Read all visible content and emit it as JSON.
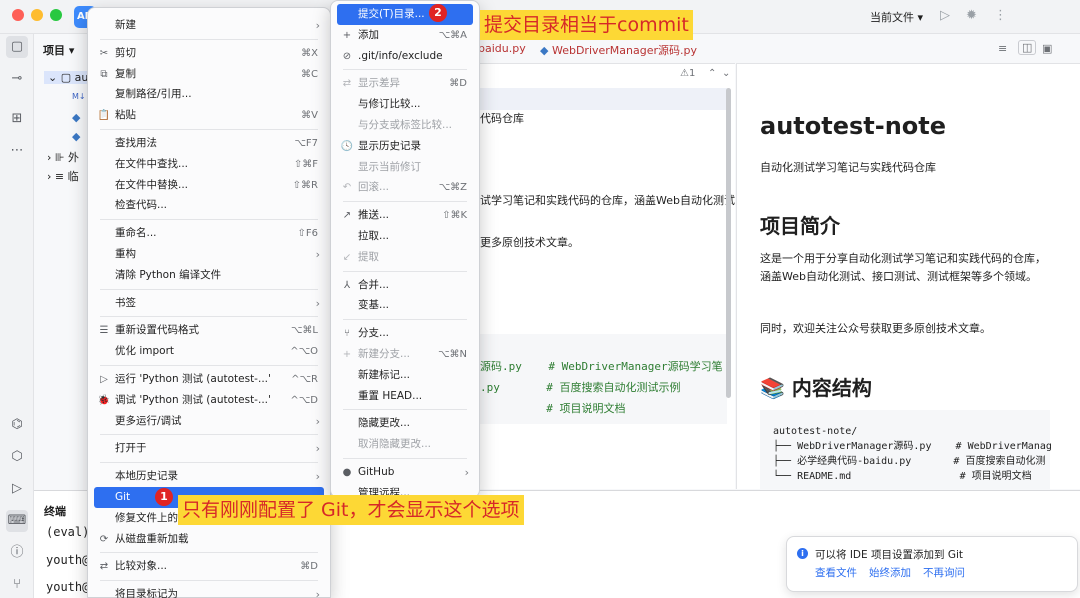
{
  "titlebar": {
    "current_file": "当前文件 ▾",
    "app_short": "AN"
  },
  "project": {
    "title": "项目 ▾",
    "items": [
      "au",
      "外",
      "临"
    ]
  },
  "editor": {
    "tab1": "baidu.py",
    "tab2": "WebDriverManager源码.py",
    "warn": "⚠1",
    "line_subtitle": "代码仓库",
    "line_desc": "试学习笔记和实践代码的仓库，涵盖Web自动化测试",
    "line_more": "更多原创技术文章。",
    "code1": "源码.py    # WebDriverManager源码学习笔",
    "code2": ".py       # 百度搜索自动化测试示例",
    "code3": "          # 项目说明文档"
  },
  "preview": {
    "h1": "autotest-note",
    "subtitle": "自动化测试学习笔记与实践代码仓库",
    "h2": "项目简介",
    "p1": "这是一个用于分享自动化测试学习笔记和实践代码的仓库，涵盖Web自动化测试、接口测试、测试框架等多个领域。",
    "p2": "同时，欢迎关注公众号获取更多原创技术文章。",
    "h2b": "📚 内容结构",
    "code": [
      "autotest-note/",
      "├── WebDriverManager源码.py    # WebDriverManag",
      "├── 必学经典代码-baidu.py       # 百度搜索自动化测",
      "└── README.md                  # 项目说明文档"
    ]
  },
  "terminal": {
    "tab": "终端",
    "lines": [
      "(eval)",
      "youth@",
      "youth@"
    ]
  },
  "context_menu": [
    {
      "label": "新建",
      "sc": "",
      "icon": "",
      "arrow": true,
      "dis": false
    },
    {
      "sep": true
    },
    {
      "label": "剪切",
      "sc": "⌘X",
      "icon": "✂",
      "dis": false
    },
    {
      "label": "复制",
      "sc": "⌘C",
      "icon": "⧉",
      "dis": false
    },
    {
      "label": "复制路径/引用...",
      "sc": "",
      "icon": "",
      "dis": false
    },
    {
      "label": "粘贴",
      "sc": "⌘V",
      "icon": "📋",
      "dis": false
    },
    {
      "sep": true
    },
    {
      "label": "查找用法",
      "sc": "⌥F7",
      "icon": "",
      "dis": false
    },
    {
      "label": "在文件中查找...",
      "sc": "⇧⌘F",
      "icon": "",
      "dis": false
    },
    {
      "label": "在文件中替换...",
      "sc": "⇧⌘R",
      "icon": "",
      "dis": false
    },
    {
      "label": "检查代码...",
      "sc": "",
      "icon": "",
      "dis": false
    },
    {
      "sep": true
    },
    {
      "label": "重命名...",
      "sc": "⇧F6",
      "icon": "",
      "dis": false
    },
    {
      "label": "重构",
      "sc": "",
      "icon": "",
      "arrow": true,
      "dis": false
    },
    {
      "label": "清除 Python 编译文件",
      "sc": "",
      "icon": "",
      "dis": false
    },
    {
      "sep": true
    },
    {
      "label": "书签",
      "sc": "",
      "icon": "",
      "arrow": true,
      "dis": false
    },
    {
      "sep": true
    },
    {
      "label": "重新设置代码格式",
      "sc": "⌥⌘L",
      "icon": "☰",
      "dis": false
    },
    {
      "label": "优化 import",
      "sc": "^⌥O",
      "icon": "",
      "dis": false
    },
    {
      "sep": true
    },
    {
      "label": "运行 'Python 测试 (autotest-...'",
      "sc": "^⌥R",
      "icon": "▷",
      "dis": false
    },
    {
      "label": "调试 'Python 测试 (autotest-...'",
      "sc": "^⌥D",
      "icon": "🐞",
      "dis": false
    },
    {
      "label": "更多运行/调试",
      "sc": "",
      "icon": "",
      "arrow": true,
      "dis": false
    },
    {
      "sep": true
    },
    {
      "label": "打开于",
      "sc": "",
      "icon": "",
      "arrow": true,
      "dis": false
    },
    {
      "sep": true
    },
    {
      "label": "本地历史记录",
      "sc": "",
      "icon": "",
      "arrow": true,
      "dis": false
    },
    {
      "label": "Git",
      "sc": "",
      "icon": "",
      "arrow": true,
      "sel": true,
      "dis": false
    },
    {
      "label": "修复文件上的 IDE",
      "sc": "",
      "icon": "",
      "dis": false
    },
    {
      "label": "从磁盘重新加载",
      "sc": "",
      "icon": "⟳",
      "dis": false
    },
    {
      "sep": true
    },
    {
      "label": "比较对象...",
      "sc": "⌘D",
      "icon": "⇄",
      "dis": false
    },
    {
      "sep": true
    },
    {
      "label": "将目录标记为",
      "sc": "",
      "icon": "",
      "arrow": true,
      "dis": false
    }
  ],
  "git_menu": [
    {
      "label": "提交(T)目录...",
      "sc": "",
      "icon": "",
      "sel": true,
      "dis": false
    },
    {
      "label": "添加",
      "sc": "⌥⌘A",
      "icon": "+",
      "dis": false
    },
    {
      "label": ".git/info/exclude",
      "sc": "",
      "icon": "⊘",
      "dis": false
    },
    {
      "sep": true
    },
    {
      "label": "显示差异",
      "sc": "⌘D",
      "icon": "⇄",
      "dis": true
    },
    {
      "label": "与修订比较...",
      "sc": "",
      "icon": "",
      "dis": false
    },
    {
      "label": "与分支或标签比较...",
      "sc": "",
      "icon": "",
      "dis": true
    },
    {
      "label": "显示历史记录",
      "sc": "",
      "icon": "🕓",
      "dis": false
    },
    {
      "label": "显示当前修订",
      "sc": "",
      "icon": "",
      "dis": true
    },
    {
      "label": "回滚...",
      "sc": "⌥⌘Z",
      "icon": "↶",
      "dis": true
    },
    {
      "sep": true
    },
    {
      "label": "推送...",
      "sc": "⇧⌘K",
      "icon": "↗",
      "dis": false
    },
    {
      "label": "拉取...",
      "sc": "",
      "icon": "",
      "dis": false
    },
    {
      "label": "提取",
      "sc": "",
      "icon": "↙",
      "dis": true
    },
    {
      "sep": true
    },
    {
      "label": "合并...",
      "sc": "",
      "icon": "⅄",
      "dis": false
    },
    {
      "label": "变基...",
      "sc": "",
      "icon": "",
      "dis": false
    },
    {
      "sep": true
    },
    {
      "label": "分支...",
      "sc": "",
      "icon": "⑂",
      "dis": false
    },
    {
      "label": "新建分支...",
      "sc": "⌥⌘N",
      "icon": "+",
      "dis": true
    },
    {
      "label": "新建标记...",
      "sc": "",
      "icon": "",
      "dis": false
    },
    {
      "label": "重置 HEAD...",
      "sc": "",
      "icon": "",
      "dis": false
    },
    {
      "sep": true
    },
    {
      "label": "隐藏更改...",
      "sc": "",
      "icon": "",
      "dis": false
    },
    {
      "label": "取消隐藏更改...",
      "sc": "",
      "icon": "",
      "dis": true
    },
    {
      "sep": true
    },
    {
      "label": "GitHub",
      "sc": "",
      "icon": "●",
      "arrow": true,
      "dis": false
    },
    {
      "label": "管理远程...",
      "sc": "",
      "icon": "",
      "dis": false
    }
  ],
  "annotations": {
    "a1": "提交目录相当于commit",
    "a2": "只有刚刚配置了 Git，才会显示这个选项",
    "b1": "1",
    "b2": "2"
  },
  "notification": {
    "text": "可以将 IDE 项目设置添加到 Git",
    "link1": "查看文件",
    "link2": "始终添加",
    "link3": "不再询问"
  },
  "colors": {
    "accent": "#2e6ff0",
    "annotation_bg": "#fdd835",
    "annotation_text": "#d62828"
  }
}
